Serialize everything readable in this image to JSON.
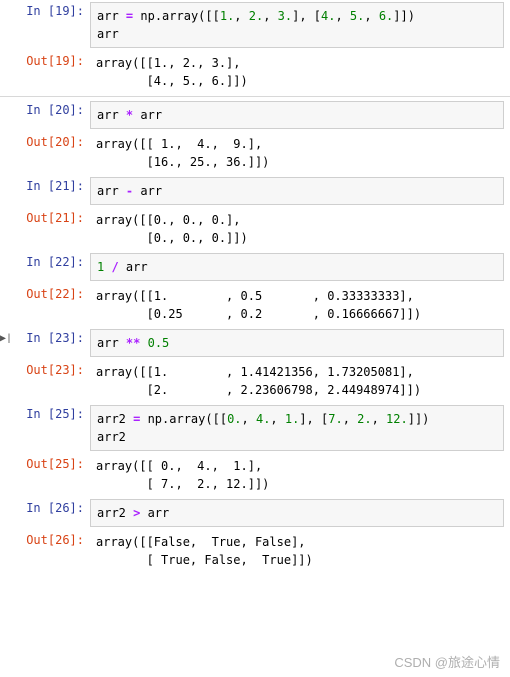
{
  "cells": [
    {
      "in_label": "In  [19]:",
      "out_label": "Out[19]:",
      "code": {
        "prefix": "arr ",
        "op": "=",
        "mid": " np.array([[",
        "nums": [
          "1.",
          "2.",
          "3."
        ],
        "mid2": "], [",
        "nums2": [
          "4.",
          "5.",
          "6."
        ],
        "suffix": "]])",
        "line2": "arr"
      },
      "output": "array([[1., 2., 3.],\n       [4., 5., 6.]])"
    },
    {
      "in_label": "In  [20]:",
      "out_label": "Out[20]:",
      "code": {
        "prefix": "arr ",
        "op": "*",
        "suffix": " arr"
      },
      "output": "array([[ 1.,  4.,  9.],\n       [16., 25., 36.]])"
    },
    {
      "in_label": "In  [21]:",
      "out_label": "Out[21]:",
      "code": {
        "prefix": "arr ",
        "op": "-",
        "suffix": " arr"
      },
      "output": "array([[0., 0., 0.],\n       [0., 0., 0.]])"
    },
    {
      "in_label": "In  [22]:",
      "out_label": "Out[22]:",
      "code": {
        "num": "1",
        "mid": " ",
        "op": "/",
        "suffix": " arr"
      },
      "output": "array([[1.        , 0.5       , 0.33333333],\n       [0.25      , 0.2       , 0.16666667]])"
    },
    {
      "in_label": "In  [23]:",
      "out_label": "Out[23]:",
      "marker": "▶|",
      "code": {
        "prefix": "arr ",
        "op": "**",
        "mid": " ",
        "num": "0.5"
      },
      "output": "array([[1.        , 1.41421356, 1.73205081],\n       [2.        , 2.23606798, 2.44948974]])"
    },
    {
      "in_label": "In  [25]:",
      "out_label": "Out[25]:",
      "code": {
        "prefix": "arr2 ",
        "op": "=",
        "mid": " np.array([[",
        "nums": [
          "0.",
          "4.",
          "1."
        ],
        "mid2": "], [",
        "nums2": [
          "7.",
          "2.",
          "12."
        ],
        "suffix": "]])",
        "line2": "arr2"
      },
      "output": "array([[ 0.,  4.,  1.],\n       [ 7.,  2., 12.]])"
    },
    {
      "in_label": "In  [26]:",
      "out_label": "Out[26]:",
      "code": {
        "prefix": "arr2 ",
        "op": ">",
        "suffix": " arr"
      },
      "output": "array([[False,  True, False],\n       [ True, False,  True]])"
    }
  ],
  "watermark": "CSDN @旅途心情"
}
